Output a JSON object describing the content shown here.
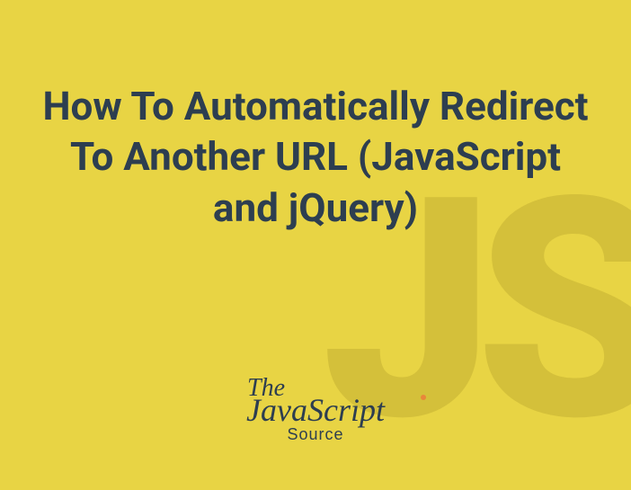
{
  "title": "How To Automatically Redirect To Another URL (JavaScript and jQuery)",
  "background_text": "JS",
  "logo": {
    "prefix": "The",
    "main": "JavaScript",
    "suffix": "Source"
  },
  "colors": {
    "background": "#e8d444",
    "text": "#2d3e50",
    "accent": "#e8863a",
    "bg_letters": "#d4c03a"
  }
}
